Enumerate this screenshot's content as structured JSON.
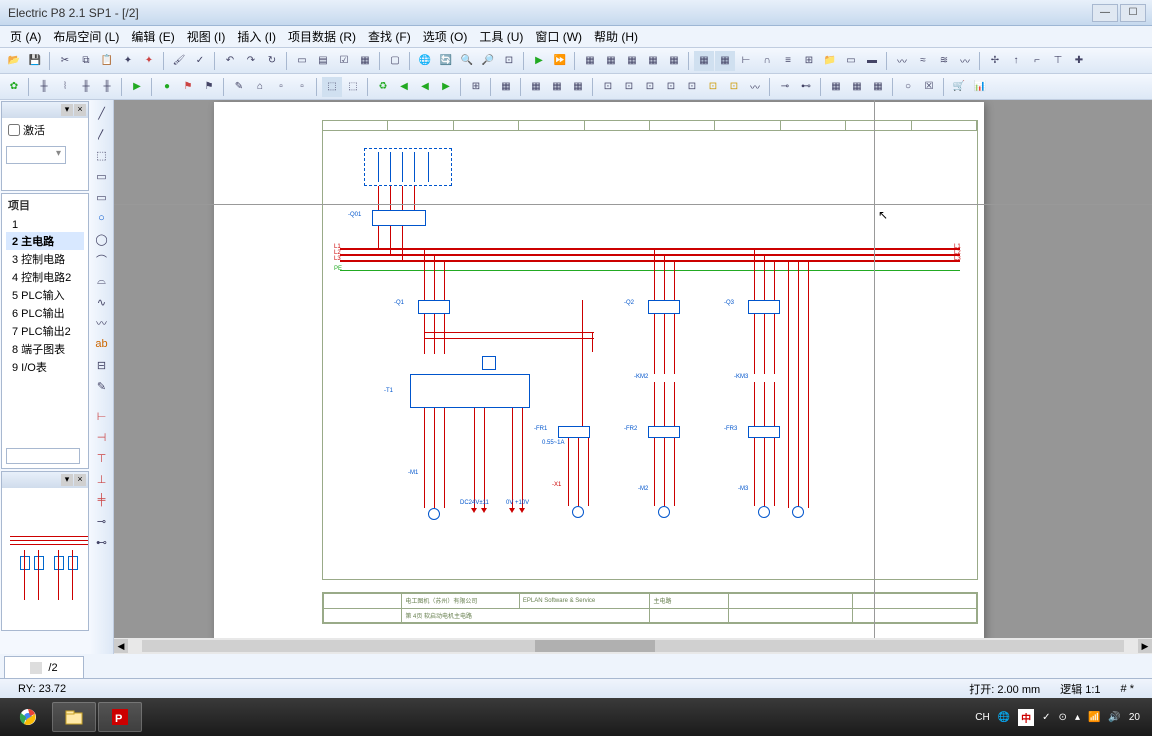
{
  "window": {
    "title": "Electric P8 2.1 SP1 - [/2]"
  },
  "menu": {
    "items": [
      "页 (A)",
      "布局空间 (L)",
      "编辑 (E)",
      "视图 (I)",
      "插入 (I)",
      "项目数据 (R)",
      "查找 (F)",
      "选项 (O)",
      "工具 (U)",
      "窗口 (W)",
      "帮助 (H)"
    ]
  },
  "filter": {
    "activate_label": "激活"
  },
  "tree": {
    "header": "项目",
    "items": [
      {
        "id": "1",
        "label": "1"
      },
      {
        "id": "2",
        "label": "2 主电路",
        "selected": true
      },
      {
        "id": "3",
        "label": "3 控制电路"
      },
      {
        "id": "4",
        "label": "4 控制电路2"
      },
      {
        "id": "5",
        "label": "5 PLC输入"
      },
      {
        "id": "6",
        "label": "6 PLC输出"
      },
      {
        "id": "7",
        "label": "7 PLC输出2"
      },
      {
        "id": "8",
        "label": "8 端子图表"
      },
      {
        "id": "9",
        "label": "9 I/O表"
      }
    ]
  },
  "titleblock": {
    "company": "电工图机（苏州）有限公司",
    "software": "EPLAN Software & Service",
    "desc": "第 4页 软启动电机主电路",
    "type": "主电路"
  },
  "pagetab": {
    "label": "/2"
  },
  "status": {
    "ry": "RY: 23.72",
    "grid": "打开: 2.00 mm",
    "zoom": "逻辑 1:1",
    "mode": "# *"
  },
  "tray": {
    "ime1": "CH",
    "ime2": "中",
    "time": "20"
  }
}
